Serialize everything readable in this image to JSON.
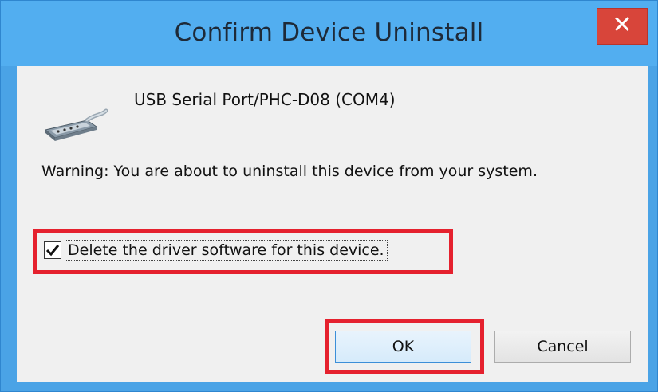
{
  "dialog": {
    "title": "Confirm Device Uninstall",
    "close_label": "✕",
    "device_name": "USB Serial Port/PHC-D08 (COM4)",
    "device_icon": "serial-port-icon",
    "warning_text": "Warning: You are about to uninstall this device from your system.",
    "checkbox_label": "Delete the driver software for this device.",
    "checkbox_checked": true,
    "ok_label": "OK",
    "cancel_label": "Cancel",
    "highlight_color": "#e5212e",
    "titlebar_color": "#52aef0",
    "close_color": "#d8453a"
  }
}
